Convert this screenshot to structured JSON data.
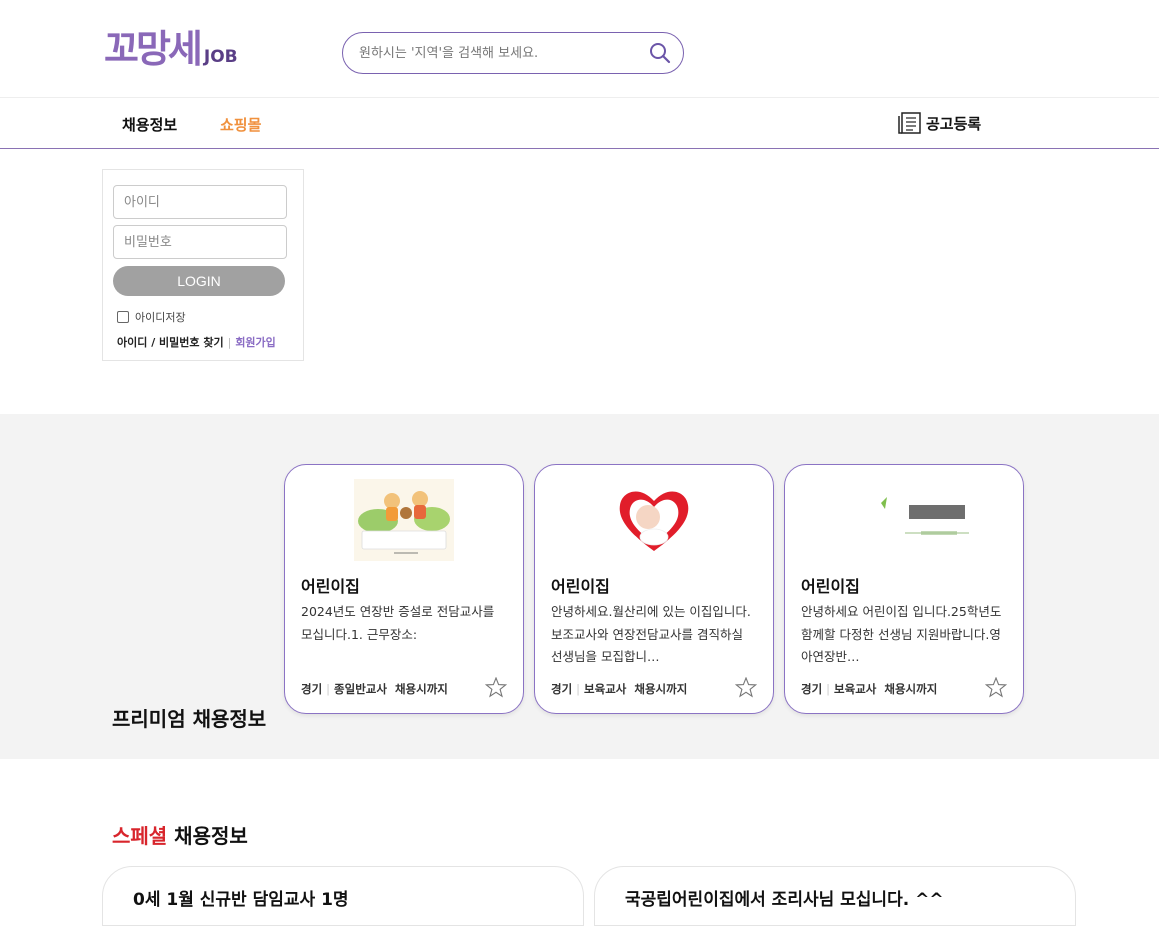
{
  "header": {
    "logo_main": "꼬망세",
    "logo_sub": "JOB",
    "search_placeholder": "원하시는 '지역'을 검색해 보세요."
  },
  "nav": {
    "jobs": "채용정보",
    "shop": "쇼핑몰",
    "post": "공고등록"
  },
  "login": {
    "id_placeholder": "아이디",
    "pw_placeholder": "비밀번호",
    "button": "LOGIN",
    "save_id": "아이디저장",
    "find": "아이디 / 비밀번호 찾기",
    "join": "회원가입"
  },
  "premium": {
    "title": "프리미엄 채용정보",
    "cards": [
      {
        "name": "어린이집",
        "desc": "2024년도 연장반 증설로 전담교사를 모십니다.1. 근무장소:",
        "region": "경기",
        "role": "종일반교사",
        "deadline": "채용시까지"
      },
      {
        "name": "어린이집",
        "desc": "안녕하세요.월산리에 있는 이집입니다.보조교사와 연장전담교사를 겸직하실 선생님을 모집합니…",
        "region": "경기",
        "role": "보육교사",
        "deadline": "채용시까지"
      },
      {
        "name": "어린이집",
        "desc": "안녕하세요 어린이집 입니다.25학년도 함께할 다정한 선생님 지원바랍니다.영아연장반…",
        "region": "경기",
        "role": "보육교사",
        "deadline": "채용시까지"
      }
    ]
  },
  "special": {
    "title_accent": "스페셜",
    "title_rest": " 채용정보",
    "cards": [
      {
        "title": "0세 1월 신규반 담임교사 1명"
      },
      {
        "title": "국공립어린이집에서 조리사님 모십니다. ^^"
      }
    ]
  },
  "colors": {
    "brand_purple": "#8a68b8",
    "shop_orange": "#f0913e",
    "special_red": "#d8252c",
    "card_border": "#8b73c4"
  }
}
